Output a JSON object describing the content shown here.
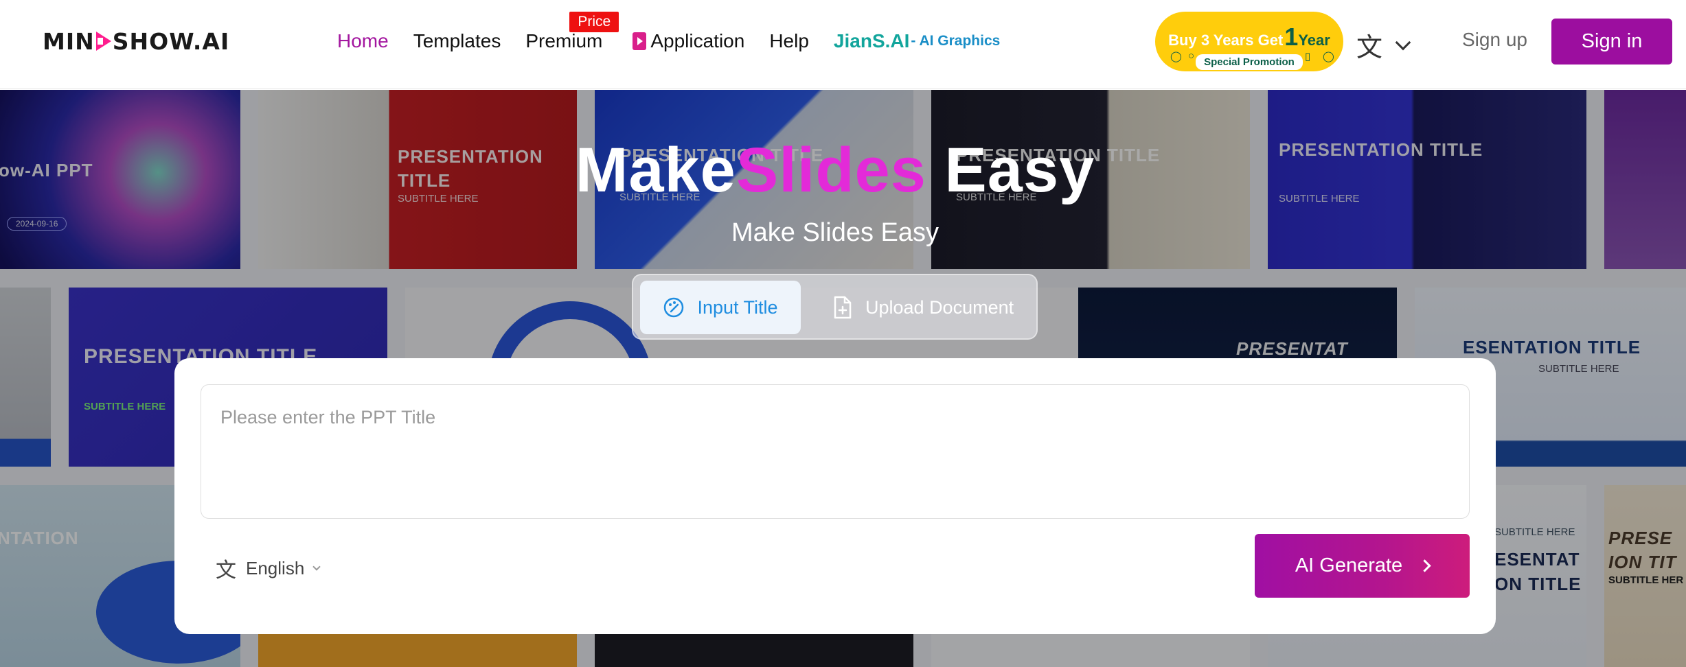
{
  "header": {
    "logo_text": "MINDSHOW.AI",
    "nav": {
      "home": "Home",
      "templates": "Templates",
      "premium": "Premium",
      "price_badge": "Price",
      "application": "Application",
      "help": "Help",
      "jians_ai": "JianS.AI",
      "ai_graphics": "- AI Graphics"
    },
    "promo": {
      "prefix": "Buy 3 Years Get",
      "number": "1",
      "suffix": "Year",
      "tag": "Special Promotion"
    },
    "language_icon": "translate-icon",
    "signup": "Sign up",
    "signin": "Sign in"
  },
  "hero": {
    "title_part1": "Make",
    "title_part2": "Slides",
    "title_part3": "Easy",
    "subtitle": "Make Slides Easy"
  },
  "tabs": {
    "input_title": "Input Title",
    "upload_document": "Upload Document"
  },
  "form": {
    "placeholder": "Please enter the PPT Title",
    "language": "English",
    "generate": "AI Generate"
  },
  "background_tiles": {
    "tile_a_title": "ow-AI PPT",
    "tile_a_date": "2024-09-16",
    "tile_b_title": "PRESENTATION TITLE",
    "tile_b_sub": "SUBTITLE HERE",
    "tile_c_title": "PRESENTATION TITLE",
    "tile_c_sub": "SUBTITLE HERE",
    "tile_d_title": "PRESENTATION TITLE",
    "tile_d_sub": "SUBTITLE HERE",
    "tile_e_title": "PRESENTATION TITLE",
    "tile_e_sub": "SUBTITLE HERE",
    "tile_f_title": "PRESENTATION TITLE",
    "tile_f_sub": "SUBTITLE HERE",
    "tile_g_title": "PRESENTAT",
    "tile_h_title": "ESENTATION TITLE",
    "tile_h_sub": "SUBTITLE HERE",
    "tile_i_title": "NTATION",
    "tile_j_title": "ESENTAT ON TITLE",
    "tile_j_sub": "SUBTITLE HERE",
    "tile_k_title": "PRESE ION TIT",
    "tile_k_sub": "SUBTITLE HER"
  },
  "colors": {
    "brand_purple": "#9c0e9f",
    "accent_magenta": "#e32ad8",
    "link_blue": "#1f8de0",
    "promo_yellow": "#ffcd0c"
  }
}
